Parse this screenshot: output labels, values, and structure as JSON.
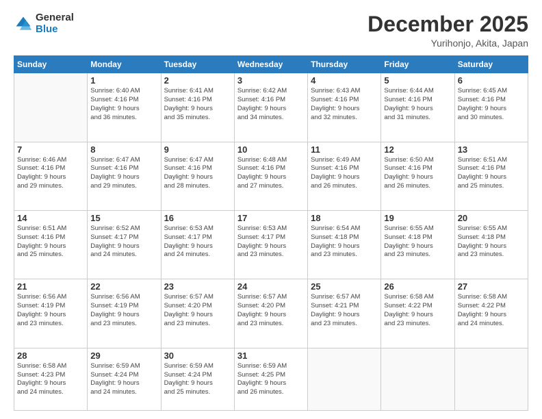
{
  "logo": {
    "general": "General",
    "blue": "Blue"
  },
  "header": {
    "month": "December 2025",
    "location": "Yurihonjo, Akita, Japan"
  },
  "weekdays": [
    "Sunday",
    "Monday",
    "Tuesday",
    "Wednesday",
    "Thursday",
    "Friday",
    "Saturday"
  ],
  "weeks": [
    [
      {
        "day": "",
        "info": ""
      },
      {
        "day": "1",
        "info": "Sunrise: 6:40 AM\nSunset: 4:16 PM\nDaylight: 9 hours\nand 36 minutes."
      },
      {
        "day": "2",
        "info": "Sunrise: 6:41 AM\nSunset: 4:16 PM\nDaylight: 9 hours\nand 35 minutes."
      },
      {
        "day": "3",
        "info": "Sunrise: 6:42 AM\nSunset: 4:16 PM\nDaylight: 9 hours\nand 34 minutes."
      },
      {
        "day": "4",
        "info": "Sunrise: 6:43 AM\nSunset: 4:16 PM\nDaylight: 9 hours\nand 32 minutes."
      },
      {
        "day": "5",
        "info": "Sunrise: 6:44 AM\nSunset: 4:16 PM\nDaylight: 9 hours\nand 31 minutes."
      },
      {
        "day": "6",
        "info": "Sunrise: 6:45 AM\nSunset: 4:16 PM\nDaylight: 9 hours\nand 30 minutes."
      }
    ],
    [
      {
        "day": "7",
        "info": "Sunrise: 6:46 AM\nSunset: 4:16 PM\nDaylight: 9 hours\nand 29 minutes."
      },
      {
        "day": "8",
        "info": "Sunrise: 6:47 AM\nSunset: 4:16 PM\nDaylight: 9 hours\nand 29 minutes."
      },
      {
        "day": "9",
        "info": "Sunrise: 6:47 AM\nSunset: 4:16 PM\nDaylight: 9 hours\nand 28 minutes."
      },
      {
        "day": "10",
        "info": "Sunrise: 6:48 AM\nSunset: 4:16 PM\nDaylight: 9 hours\nand 27 minutes."
      },
      {
        "day": "11",
        "info": "Sunrise: 6:49 AM\nSunset: 4:16 PM\nDaylight: 9 hours\nand 26 minutes."
      },
      {
        "day": "12",
        "info": "Sunrise: 6:50 AM\nSunset: 4:16 PM\nDaylight: 9 hours\nand 26 minutes."
      },
      {
        "day": "13",
        "info": "Sunrise: 6:51 AM\nSunset: 4:16 PM\nDaylight: 9 hours\nand 25 minutes."
      }
    ],
    [
      {
        "day": "14",
        "info": "Sunrise: 6:51 AM\nSunset: 4:16 PM\nDaylight: 9 hours\nand 25 minutes."
      },
      {
        "day": "15",
        "info": "Sunrise: 6:52 AM\nSunset: 4:17 PM\nDaylight: 9 hours\nand 24 minutes."
      },
      {
        "day": "16",
        "info": "Sunrise: 6:53 AM\nSunset: 4:17 PM\nDaylight: 9 hours\nand 24 minutes."
      },
      {
        "day": "17",
        "info": "Sunrise: 6:53 AM\nSunset: 4:17 PM\nDaylight: 9 hours\nand 23 minutes."
      },
      {
        "day": "18",
        "info": "Sunrise: 6:54 AM\nSunset: 4:18 PM\nDaylight: 9 hours\nand 23 minutes."
      },
      {
        "day": "19",
        "info": "Sunrise: 6:55 AM\nSunset: 4:18 PM\nDaylight: 9 hours\nand 23 minutes."
      },
      {
        "day": "20",
        "info": "Sunrise: 6:55 AM\nSunset: 4:18 PM\nDaylight: 9 hours\nand 23 minutes."
      }
    ],
    [
      {
        "day": "21",
        "info": "Sunrise: 6:56 AM\nSunset: 4:19 PM\nDaylight: 9 hours\nand 23 minutes."
      },
      {
        "day": "22",
        "info": "Sunrise: 6:56 AM\nSunset: 4:19 PM\nDaylight: 9 hours\nand 23 minutes."
      },
      {
        "day": "23",
        "info": "Sunrise: 6:57 AM\nSunset: 4:20 PM\nDaylight: 9 hours\nand 23 minutes."
      },
      {
        "day": "24",
        "info": "Sunrise: 6:57 AM\nSunset: 4:20 PM\nDaylight: 9 hours\nand 23 minutes."
      },
      {
        "day": "25",
        "info": "Sunrise: 6:57 AM\nSunset: 4:21 PM\nDaylight: 9 hours\nand 23 minutes."
      },
      {
        "day": "26",
        "info": "Sunrise: 6:58 AM\nSunset: 4:22 PM\nDaylight: 9 hours\nand 23 minutes."
      },
      {
        "day": "27",
        "info": "Sunrise: 6:58 AM\nSunset: 4:22 PM\nDaylight: 9 hours\nand 24 minutes."
      }
    ],
    [
      {
        "day": "28",
        "info": "Sunrise: 6:58 AM\nSunset: 4:23 PM\nDaylight: 9 hours\nand 24 minutes."
      },
      {
        "day": "29",
        "info": "Sunrise: 6:59 AM\nSunset: 4:24 PM\nDaylight: 9 hours\nand 24 minutes."
      },
      {
        "day": "30",
        "info": "Sunrise: 6:59 AM\nSunset: 4:24 PM\nDaylight: 9 hours\nand 25 minutes."
      },
      {
        "day": "31",
        "info": "Sunrise: 6:59 AM\nSunset: 4:25 PM\nDaylight: 9 hours\nand 26 minutes."
      },
      {
        "day": "",
        "info": ""
      },
      {
        "day": "",
        "info": ""
      },
      {
        "day": "",
        "info": ""
      }
    ]
  ]
}
